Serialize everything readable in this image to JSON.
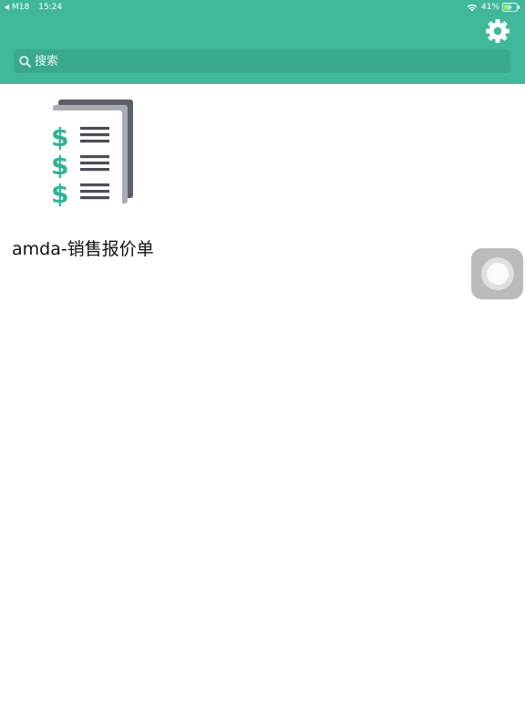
{
  "status_bar": {
    "carrier": "M18",
    "time": "15:24",
    "battery": "41%"
  },
  "header": {
    "background_color": "#40b89a",
    "settings_icon": "gear-icon"
  },
  "search": {
    "placeholder": "搜索",
    "icon": "search-icon"
  },
  "apps": [
    {
      "label": "amda-销售报价单",
      "icon": "invoice-document-icon",
      "accent_color": "#2fb394"
    }
  ]
}
